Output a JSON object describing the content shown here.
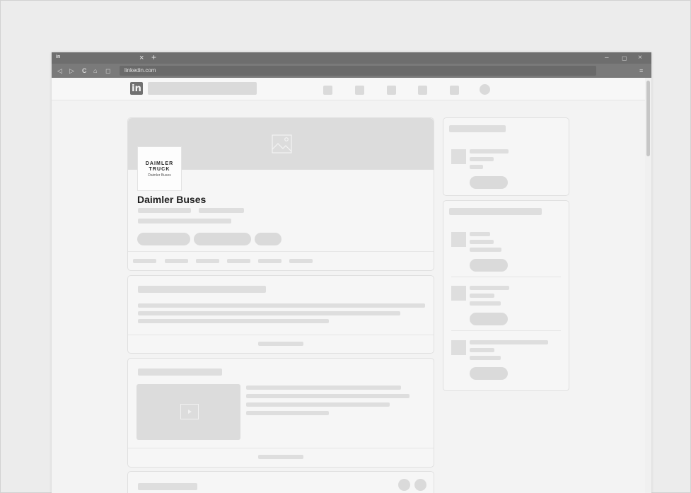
{
  "browser": {
    "tab_favicon": "in",
    "tab_close": "×",
    "new_tab": "+",
    "minimize": "–",
    "maximize": "◻",
    "close": "×",
    "nav_icons": [
      "◁",
      "▷",
      "C",
      "⌂",
      "◻"
    ],
    "url": "linkedin.com",
    "lock_icon": "🔒",
    "menu_icon": "≡"
  },
  "linkedin": {
    "logo_text": "in"
  },
  "company": {
    "name": "Daimler Buses",
    "logo_line1": "DAIMLER",
    "logo_line2": "TRUCK",
    "logo_line3": "Daimler Buses"
  },
  "colors": {
    "titlebar": "#6e6e6e",
    "navbar": "#7a7a7a",
    "placeholder": "#dedede",
    "card": "#f6f6f6"
  }
}
